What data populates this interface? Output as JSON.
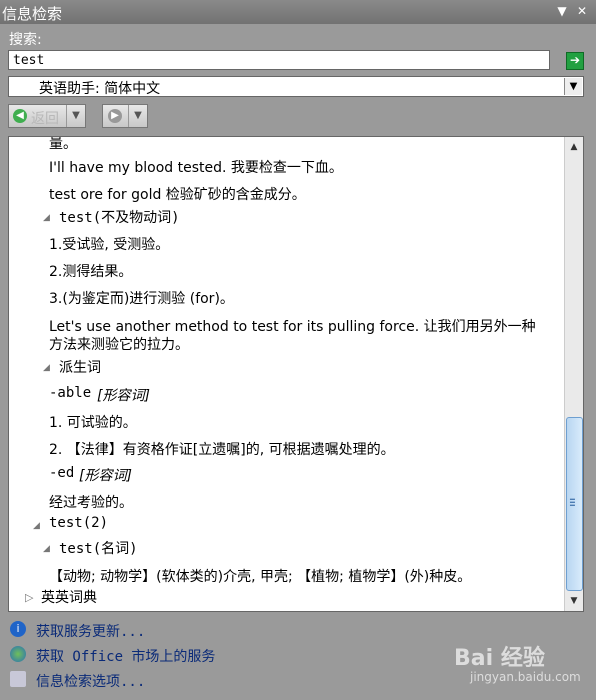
{
  "window": {
    "title": "信息检索"
  },
  "search": {
    "label": "搜索:",
    "value": "test"
  },
  "dictionary": {
    "selected": "英语助手: 简体中文"
  },
  "nav": {
    "back_label": "返回"
  },
  "content": {
    "lines": [
      "量。",
      "I'll have my blood tested. 我要检查一下血。",
      "test ore for gold 检验矿砂的含金成分。",
      "test(不及物动词)",
      "1.受试验, 受测验。",
      "2.测得结果。",
      "3.(为鉴定而)进行测验 (for)。",
      "Let's use another method to test for its pulling force. 让我们用另外一种",
      "方法来测验它的拉力。",
      "派生词",
      "-able",
      "[形容词]",
      "1. 可试验的。",
      "2. 【法律】有资格作证[立遗嘱]的, 可根据遗嘱处理的。",
      "-ed",
      "[形容词]",
      "经过考验的。",
      "test(2)",
      "test(名词)",
      "【动物; 动物学】(软体类的)介壳, 甲壳; 【植物; 植物学】(外)种皮。",
      "英英词典"
    ]
  },
  "footer": {
    "items": [
      {
        "label": "获取服务更新..."
      },
      {
        "label": "获取 Office 市场上的服务"
      },
      {
        "label": "信息检索选项..."
      }
    ]
  },
  "watermark": {
    "text": "Bai 经验",
    "sub": "jingyan.baidu.com"
  }
}
